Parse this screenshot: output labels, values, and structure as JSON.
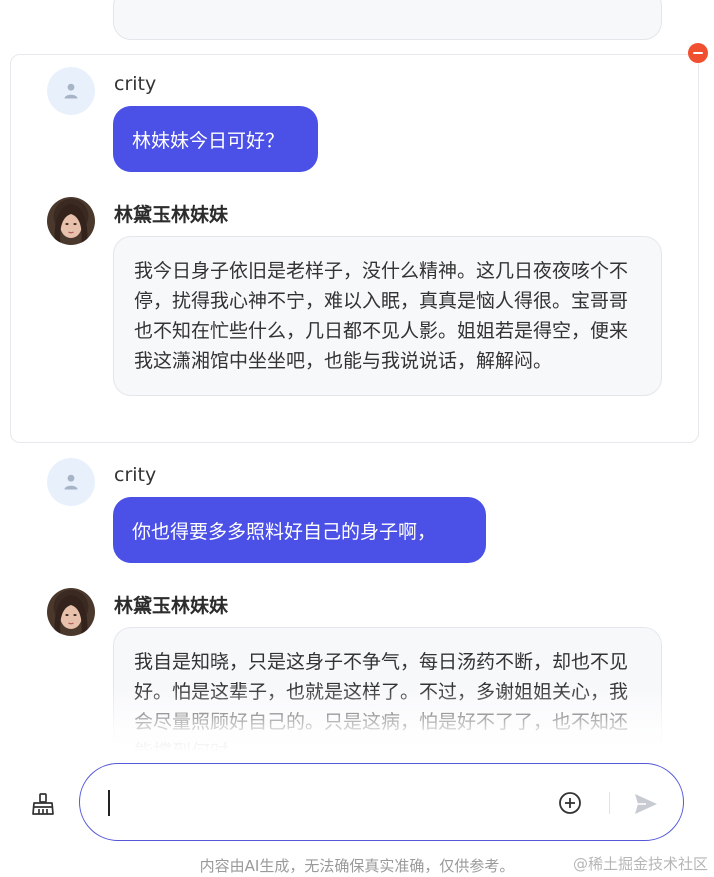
{
  "messages": [
    {
      "role": "user",
      "name": "crity",
      "text": "林妹妹今日可好？"
    },
    {
      "role": "assistant",
      "name": "林黛玉林妹妹",
      "text": "我今日身子依旧是老样子，没什么精神。这几日夜夜咳个不停，扰得我心神不宁，难以入眠，真真是恼人得很。宝哥哥也不知在忙些什么，几日都不见人影。姐姐若是得空，便来我这潇湘馆中坐坐吧，也能与我说说话，解解闷。"
    },
    {
      "role": "user",
      "name": "crity",
      "text": "你也得要多多照料好自己的身子啊，"
    },
    {
      "role": "assistant",
      "name": "林黛玉林妹妹",
      "text": "我自是知晓，只是这身子不争气，每日汤药不断，却也不见好。怕是这辈子，也就是这样了。不过，多谢姐姐关心，我会尽量照顾好自己的。只是这病，怕是好不了了，也不知还能撑到何时。"
    }
  ],
  "composer": {
    "value": "",
    "placeholder": ""
  },
  "icons": {
    "clear": "broom-icon",
    "attach": "plus-circle-icon",
    "send": "send-icon",
    "remove": "minus-circle-icon",
    "user_avatar": "user-icon"
  },
  "colors": {
    "accent": "#4b50e6",
    "remove": "#f0502f"
  },
  "footer": {
    "disclaimer": "内容由AI生成，无法确保真实准确，仅供参考。",
    "watermark": "@稀土掘金技术社区"
  }
}
